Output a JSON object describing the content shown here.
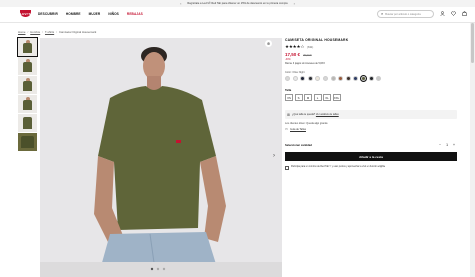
{
  "promo": {
    "text": "Regístrate a Levi's® Red Tab para obtener un 15% de descuento en tu primera compra",
    "arrow_left": "‹",
    "arrow_right": "›"
  },
  "header": {
    "logo_text": "LEVI'S",
    "nav": [
      "DESCUBRIR",
      "HOMBRE",
      "MUJER",
      "NIÑOS",
      "REBAJAS"
    ],
    "search_placeholder": "Buscar por artículo o categoría",
    "icons": [
      "user-icon",
      "heart-icon",
      "bag-icon"
    ]
  },
  "breadcrumb": [
    "Home",
    "Hombre",
    "T-shirts",
    "Camiseta Original Housemark"
  ],
  "gallery": {
    "thumb_count": 6,
    "zoom_glyph": "⊕",
    "next_glyph": "›"
  },
  "product": {
    "title": "CAMISETA ORIGINAL HOUSEMARK",
    "stars": "★★★★☆",
    "rating_count": "(631)",
    "price": "17,50 €",
    "old_price": "25,00 €",
    "discount": "-30%",
    "klarna": "Klarna. 3 pagos sin intereses de 5,83 €",
    "color_label": "Color: Olive Night",
    "swatches": [
      "#d9d9d9",
      "#e8e8e8",
      "#1d2337",
      "#2b2d33",
      "#ede7dc",
      "#d6d6d6",
      "#b9b7b3",
      "#9a5a3a",
      "#3b2f2a",
      "#2c3b63",
      "#5d6140",
      "#222428",
      "#c9c9c9"
    ],
    "selected_swatch": 10,
    "size_label": "Talla",
    "sizes": [
      "XS",
      "S",
      "M",
      "L",
      "XL",
      "XXL"
    ],
    "fit_text": "¿Qué talla te queda?",
    "fit_link": "Ver análisis de tallas",
    "fit_note": "Los clientes dicen: Queda algo grande",
    "guide": "Guía de Tallas",
    "qty_label": "Seleccionar cantidad",
    "qty_minus": "−",
    "qty_value": "1",
    "qty_plus": "+",
    "add_button": "Añadir a la cesta",
    "loyalty": "Participa para un mínimo de Red Tab™ y usar puntos y aprovechar a vivir en función eligible"
  }
}
